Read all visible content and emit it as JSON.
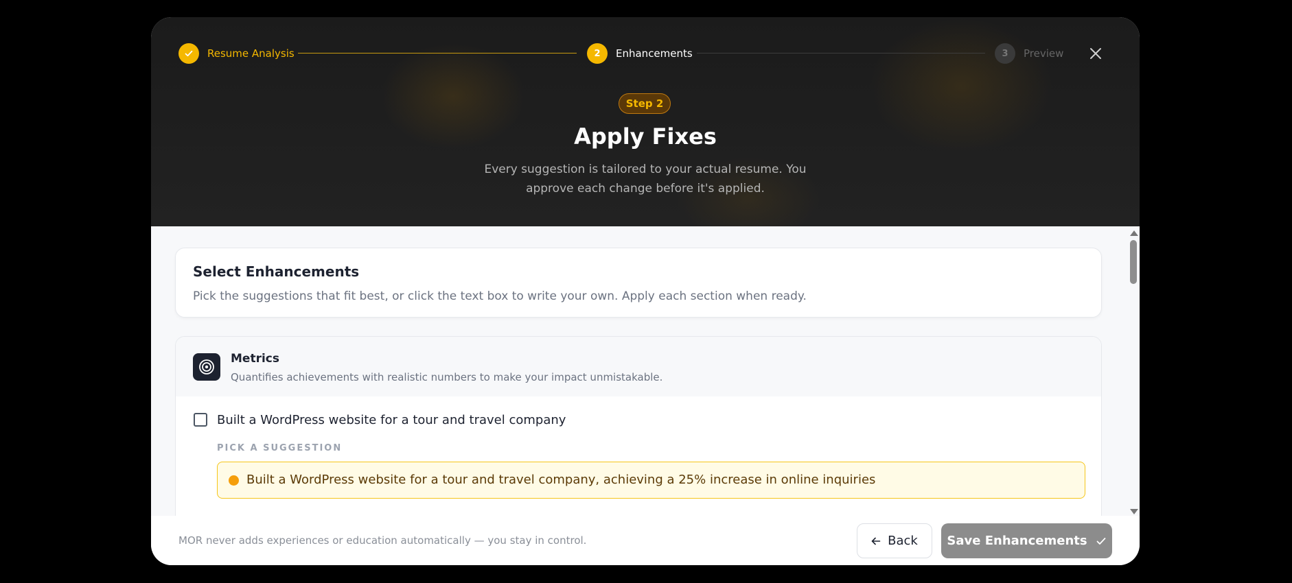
{
  "stepper": {
    "steps": [
      {
        "number": "✓",
        "label": "Resume Analysis",
        "state": "complete"
      },
      {
        "number": "2",
        "label": "Enhancements",
        "state": "active"
      },
      {
        "number": "3",
        "label": "Preview",
        "state": "upcoming"
      }
    ],
    "close_icon": "close-icon"
  },
  "header": {
    "badge": "Step 2",
    "title": "Apply Fixes",
    "subtitle": "Every suggestion is tailored to your actual resume. You approve each change before it's applied."
  },
  "select_card": {
    "title": "Select Enhancements",
    "description": "Pick the suggestions that fit best, or click the text box to write your own. Apply each section when ready."
  },
  "metrics_section": {
    "icon": "target-icon",
    "title": "Metrics",
    "description": "Quantifies achievements with realistic numbers to make your impact unmistakable.",
    "items": [
      {
        "checked": false,
        "original": "Built a WordPress website for a tour and travel company",
        "pick_label": "PICK A SUGGESTION",
        "suggestion": "Built a WordPress website for a tour and travel company, achieving a 25% increase in online inquiries"
      }
    ]
  },
  "footer": {
    "note": "MOR never adds experiences or education automatically — you stay in control.",
    "back_label": "Back",
    "save_label": "Save Enhancements"
  },
  "colors": {
    "accent": "#f5b800",
    "header_bg": "#1e1e1e",
    "save_button": "#8c8c8c",
    "suggestion_bg": "#fffbe6",
    "suggestion_border": "#f5c518"
  }
}
